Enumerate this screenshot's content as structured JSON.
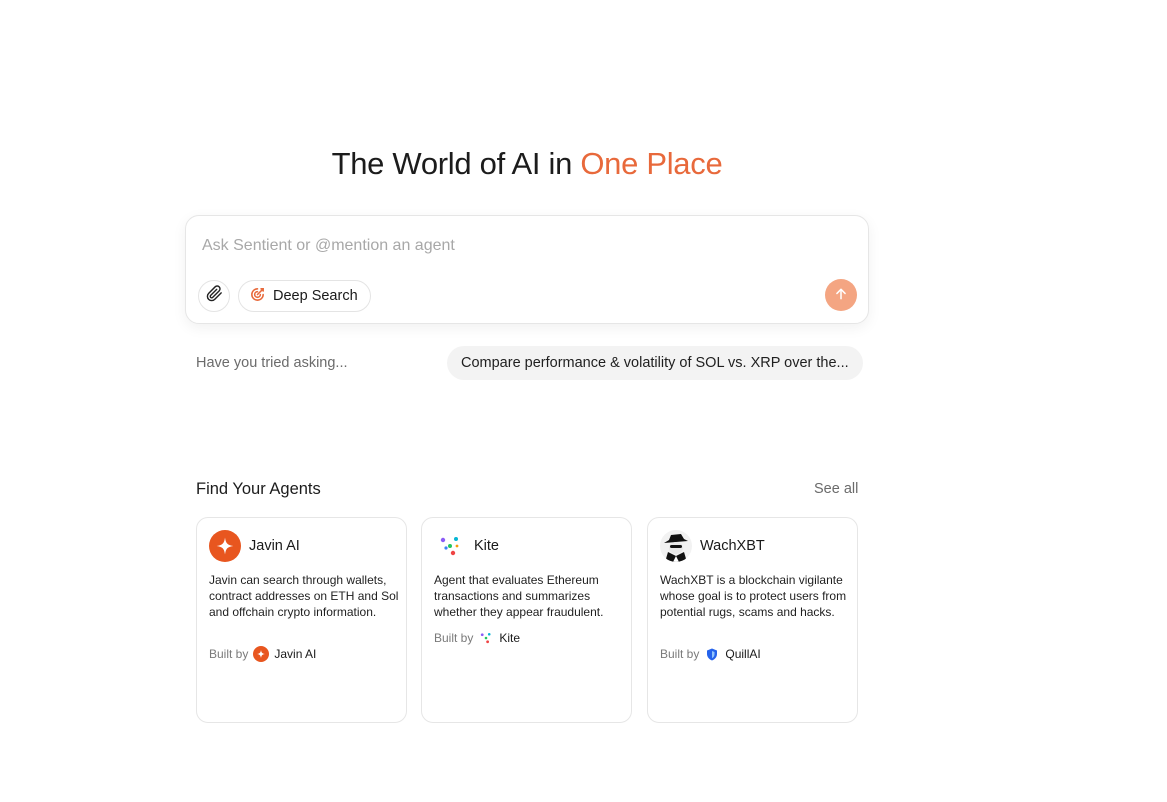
{
  "hero": {
    "title_main": "The World of AI in ",
    "title_accent": "One Place",
    "accent_color": "#e8693b"
  },
  "prompt": {
    "placeholder": "Ask Sentient or @mention an agent",
    "value": "",
    "attach_icon": "paperclip-icon",
    "deep_search_label": "Deep Search",
    "deep_search_icon": "target-search-icon",
    "send_icon": "arrow-up-icon",
    "send_color": "#f4a582"
  },
  "suggestions": {
    "label": "Have you tried asking...",
    "items": [
      "Compare performance & volatility of SOL vs. XRP over the..."
    ]
  },
  "agents": {
    "title": "Find Your Agents",
    "see_all": "See all",
    "items": [
      {
        "name": "Javin AI",
        "description": "Javin can search through wallets, contract addresses on ETH and Sol and offchain crypto information.",
        "built_by_label": "Built by",
        "built_by": "Javin AI",
        "icon": "javin-logo-icon"
      },
      {
        "name": "Kite",
        "description": "Agent that evaluates Ethereum transactions and summarizes whether they appear fraudulent.",
        "built_by_label": "Built by",
        "built_by": "Kite",
        "icon": "kite-logo-icon"
      },
      {
        "name": "WachXBT",
        "description": "WachXBT is a blockchain vigilante whose goal is to protect users from potential rugs, scams and hacks.",
        "built_by_label": "Built by",
        "built_by": "QuillAI",
        "icon": "detective-avatar-icon"
      }
    ]
  }
}
